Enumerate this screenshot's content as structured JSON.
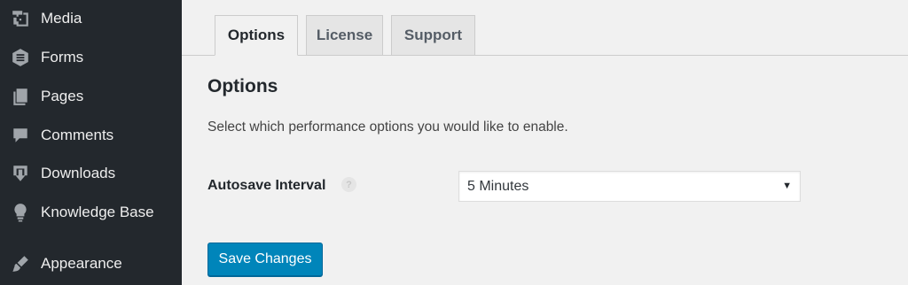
{
  "sidebar": {
    "items": [
      {
        "label": "Media",
        "icon": "media-icon"
      },
      {
        "label": "Forms",
        "icon": "forms-icon"
      },
      {
        "label": "Pages",
        "icon": "pages-icon"
      },
      {
        "label": "Comments",
        "icon": "comments-icon"
      },
      {
        "label": "Downloads",
        "icon": "downloads-icon"
      },
      {
        "label": "Knowledge Base",
        "icon": "lightbulb-icon"
      },
      {
        "label": "Appearance",
        "icon": "paintbrush-icon"
      }
    ]
  },
  "tabs": [
    {
      "label": "Options",
      "active": true
    },
    {
      "label": "License",
      "active": false
    },
    {
      "label": "Support",
      "active": false
    }
  ],
  "section": {
    "title": "Options",
    "description": "Select which performance options you would like to enable."
  },
  "fields": {
    "autosave": {
      "label": "Autosave Interval",
      "help": "?",
      "value": "5 Minutes"
    }
  },
  "actions": {
    "save_label": "Save Changes"
  },
  "colors": {
    "sidebar_bg": "#23282d",
    "primary_button": "#0085ba",
    "page_bg": "#f1f1f1"
  }
}
